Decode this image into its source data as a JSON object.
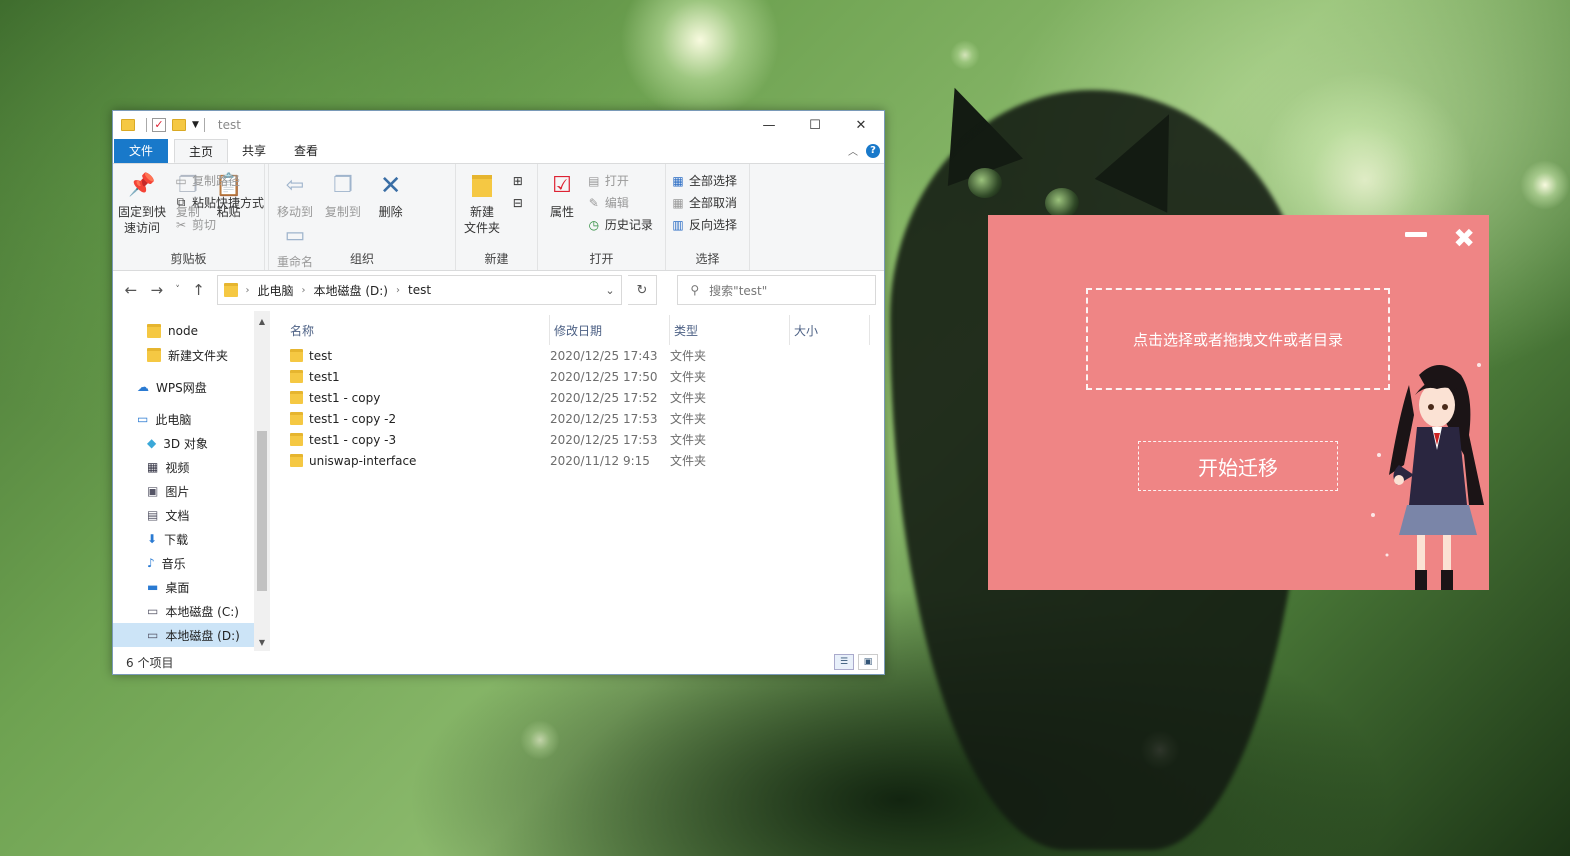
{
  "explorer": {
    "title": "test",
    "window_buttons": {
      "minimize": "—",
      "maximize": "☐",
      "close": "✕"
    },
    "tabs": [
      "文件",
      "主页",
      "共享",
      "查看"
    ],
    "ribbon": {
      "clipboard": {
        "pin_line1": "固定到快",
        "pin_line2": "速访问",
        "copy": "复制",
        "paste": "粘贴",
        "copy_path": "复制路径",
        "paste_shortcut": "粘贴快捷方式",
        "cut": "剪切",
        "group": "剪贴板"
      },
      "organize": {
        "move_to": "移动到",
        "copy_to": "复制到",
        "delete": "删除",
        "rename": "重命名",
        "group": "组织"
      },
      "new": {
        "new_folder_line1": "新建",
        "new_folder_line2": "文件夹",
        "group": "新建"
      },
      "open": {
        "properties": "属性",
        "open": "打开",
        "edit": "编辑",
        "history": "历史记录",
        "group": "打开"
      },
      "select": {
        "select_all": "全部选择",
        "select_none": "全部取消",
        "invert": "反向选择",
        "group": "选择"
      }
    },
    "address": [
      "此电脑",
      "本地磁盘 (D:)",
      "test"
    ],
    "search_placeholder": "搜索\"test\"",
    "nav_items": [
      {
        "label": "node",
        "icon": "folder-icon"
      },
      {
        "label": "新建文件夹",
        "icon": "folder-icon"
      },
      {
        "label": "WPS网盘",
        "icon": "cloud-icon"
      },
      {
        "label": "此电脑",
        "icon": "computer-icon"
      },
      {
        "label": "3D 对象",
        "icon": "3d-objects-icon"
      },
      {
        "label": "视频",
        "icon": "video-icon"
      },
      {
        "label": "图片",
        "icon": "pictures-icon"
      },
      {
        "label": "文档",
        "icon": "documents-icon"
      },
      {
        "label": "下载",
        "icon": "download-icon"
      },
      {
        "label": "音乐",
        "icon": "music-icon"
      },
      {
        "label": "桌面",
        "icon": "desktop-icon"
      },
      {
        "label": "本地磁盘 (C:)",
        "icon": "drive-icon"
      },
      {
        "label": "本地磁盘 (D:)",
        "icon": "drive-icon"
      }
    ],
    "columns": [
      "名称",
      "修改日期",
      "类型",
      "大小"
    ],
    "files": [
      {
        "name": "test",
        "date": "2020/12/25 17:43",
        "type": "文件夹"
      },
      {
        "name": "test1",
        "date": "2020/12/25 17:50",
        "type": "文件夹"
      },
      {
        "name": "test1 - copy",
        "date": "2020/12/25 17:52",
        "type": "文件夹"
      },
      {
        "name": "test1 - copy -2",
        "date": "2020/12/25 17:53",
        "type": "文件夹"
      },
      {
        "name": "test1 - copy -3",
        "date": "2020/12/25 17:53",
        "type": "文件夹"
      },
      {
        "name": "uniswap-interface",
        "date": "2020/11/12 9:15",
        "type": "文件夹"
      }
    ],
    "status": "6 个项目"
  },
  "migrator": {
    "dropzone_text": "点击选择或者拖拽文件或者目录",
    "start_button": "开始迁移",
    "close_glyph": "✖",
    "background_color": "#ef8585"
  },
  "colors": {
    "file_tab": "#1979ca",
    "selected_nav": "#cce4f7",
    "folder": "#f5c843"
  }
}
